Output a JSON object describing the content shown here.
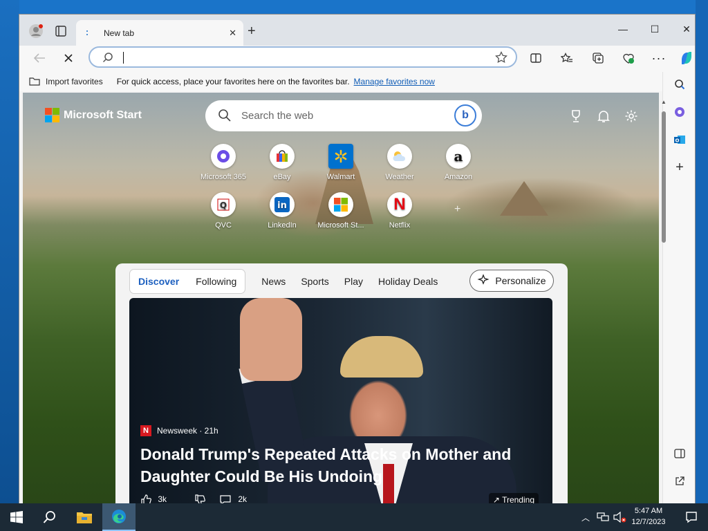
{
  "browser": {
    "tab_title": "New tab",
    "address_value": "",
    "favorites_bar": {
      "import_label": "Import favorites",
      "message": "For quick access, place your favorites here on the favorites bar.",
      "manage_link": "Manage favorites now"
    }
  },
  "newtab": {
    "brand": "Microsoft Start",
    "search_placeholder": "Search the web",
    "quick_links": [
      {
        "label": "Microsoft 365",
        "icon": "microsoft365-icon"
      },
      {
        "label": "eBay",
        "icon": "ebay-icon"
      },
      {
        "label": "Walmart",
        "icon": "walmart-icon"
      },
      {
        "label": "Weather",
        "icon": "weather-icon"
      },
      {
        "label": "Amazon",
        "icon": "amazon-icon"
      },
      {
        "label": "QVC",
        "icon": "qvc-icon"
      },
      {
        "label": "LinkedIn",
        "icon": "linkedin-icon"
      },
      {
        "label": "Microsoft St...",
        "icon": "microsoft-store-icon"
      },
      {
        "label": "Netflix",
        "icon": "netflix-icon"
      }
    ],
    "feed_tabs": [
      "Discover",
      "Following",
      "News",
      "Sports",
      "Play",
      "Holiday Deals"
    ],
    "personalize_label": "Personalize",
    "article": {
      "source": "Newsweek · 21h",
      "source_badge": "N",
      "headline": "Donald Trump's Repeated Attacks on Mother and Daughter Could Be His Undoing",
      "likes": "3k",
      "comments": "2k",
      "trending_label": "Trending"
    }
  },
  "taskbar": {
    "time": "5:47 AM",
    "date": "12/7/2023"
  },
  "colors": {
    "accent": "#1c5fbf",
    "link": "#0e5bb5",
    "taskbar": "#1c2a36"
  }
}
